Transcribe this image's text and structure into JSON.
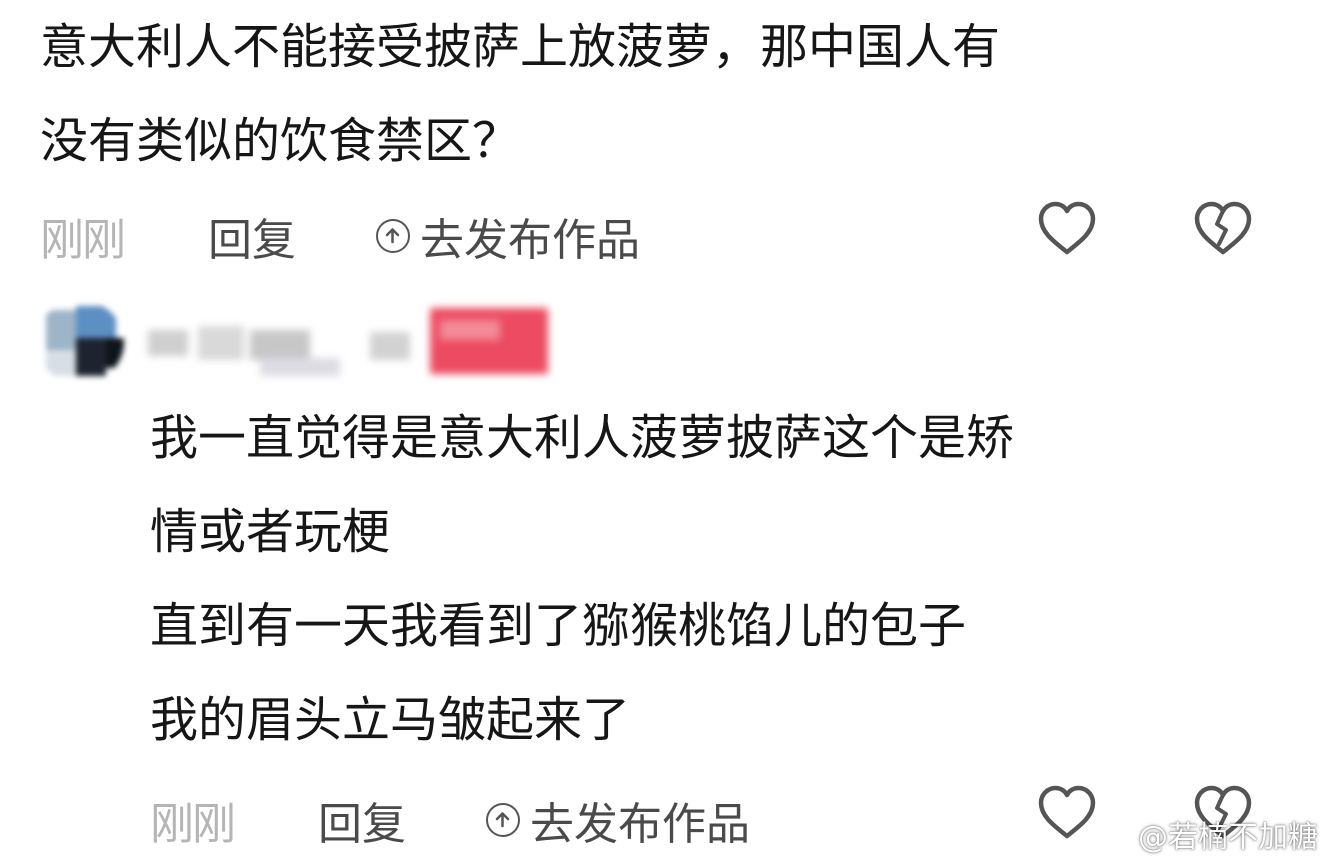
{
  "comment1": {
    "lines": [
      "意大利人不能接受披萨上放菠萝，那中国人有",
      "没有类似的饮食禁区？"
    ],
    "time": "刚刚",
    "reply_label": "回复",
    "publish_label": "去发布作品"
  },
  "comment2": {
    "lines": [
      "我一直觉得是意大利人菠萝披萨这个是矫",
      "情或者玩梗",
      "直到有一天我看到了猕猴桃馅儿的包子",
      "我的眉头立马皱起来了"
    ],
    "time": "刚刚",
    "reply_label": "回复",
    "publish_label": "去发布作品"
  },
  "icons": {
    "like": "heart-outline-icon",
    "dislike": "broken-heart-icon",
    "publish": "arrow-up-circle-icon"
  },
  "watermark": {
    "text": "@若楠不加糖"
  },
  "colors": {
    "text": "#161616",
    "muted": "#b5b5b5",
    "action": "#4a4a4a",
    "icon_stroke": "#555555"
  }
}
